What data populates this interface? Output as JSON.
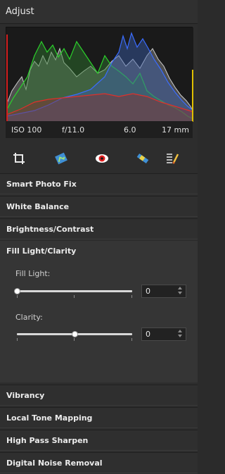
{
  "header": {
    "title": "Adjust"
  },
  "exif": {
    "iso": "ISO 100",
    "aperture": "f/11.0",
    "exposure": "6.0",
    "focal": "17 mm"
  },
  "tools": [
    {
      "icon": "crop-icon"
    },
    {
      "icon": "image-adjust-icon"
    },
    {
      "icon": "red-eye-icon"
    },
    {
      "icon": "straighten-icon"
    },
    {
      "icon": "tool-brush-icon"
    }
  ],
  "sections": {
    "smart_photo_fix": "Smart Photo Fix",
    "white_balance": "White Balance",
    "brightness_contrast": "Brightness/Contrast",
    "fill_light_clarity": "Fill Light/Clarity",
    "vibrancy": "Vibrancy",
    "local_tone_mapping": "Local Tone Mapping",
    "high_pass_sharpen": "High Pass Sharpen",
    "digital_noise_removal": "Digital Noise Removal"
  },
  "fill_light": {
    "label": "Fill Light:",
    "value": "0",
    "level": 0.0
  },
  "clarity": {
    "label": "Clarity:",
    "value": "0",
    "level": 0.5
  },
  "colors": {
    "accent_red": "#e0302a",
    "green": "#2bd12b",
    "blue": "#3a6cff"
  }
}
